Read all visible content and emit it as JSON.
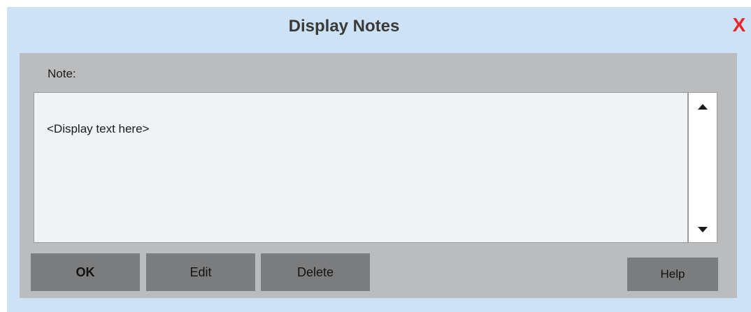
{
  "dialog": {
    "title": "Display Notes",
    "close_label": "X",
    "close_color": "#e8262a",
    "background_color": "#cde2f4"
  },
  "note": {
    "label": "Note:",
    "text": "<Display text here>"
  },
  "buttons": {
    "ok": "OK",
    "edit": "Edit",
    "delete": "Delete",
    "help": "Help"
  },
  "scrollbar": {
    "up_icon": "triangle-up-icon",
    "down_icon": "triangle-down-icon"
  }
}
